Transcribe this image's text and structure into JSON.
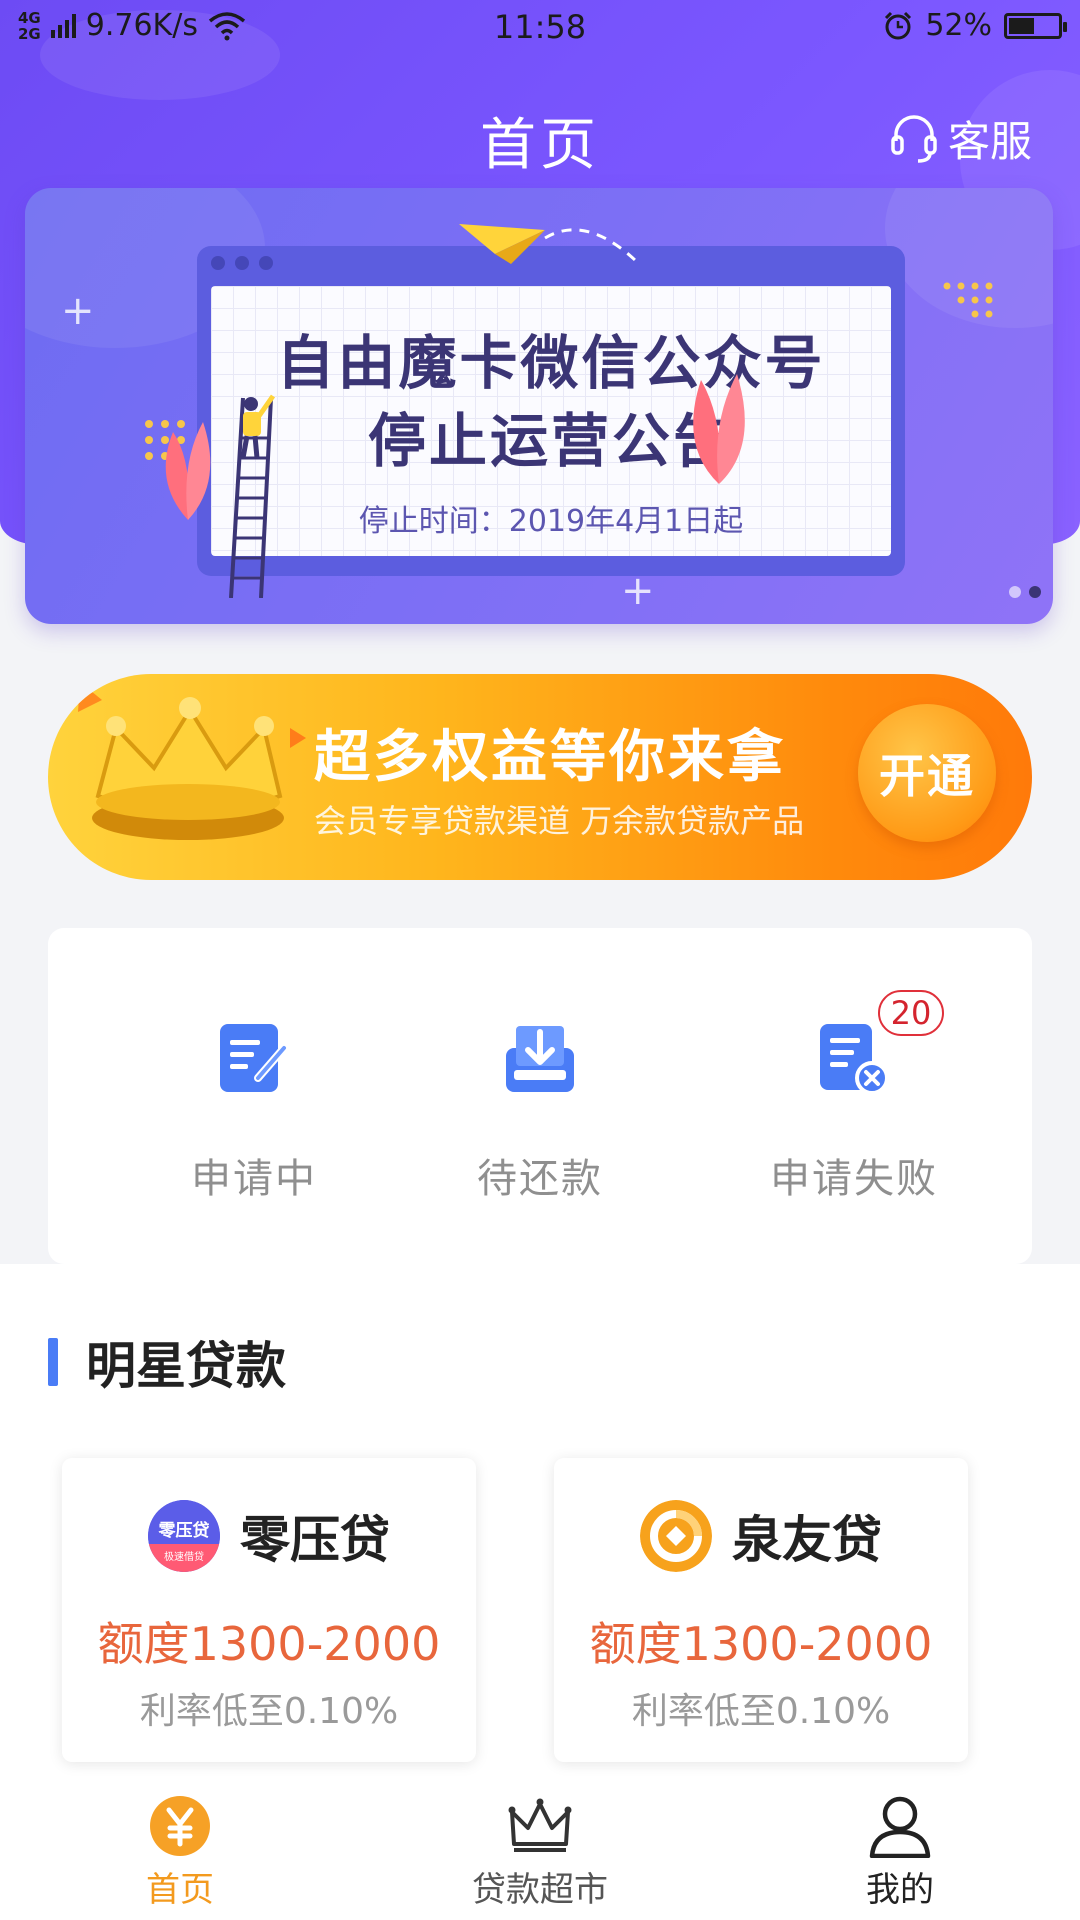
{
  "status_bar": {
    "network": "4G 2G",
    "speed": "9.76K/s",
    "time": "11:58",
    "battery": "52%",
    "battery_level": 0.52
  },
  "header": {
    "title": "首页",
    "service_label": "客服"
  },
  "banner": {
    "line1": "自由魔卡微信公众号",
    "line2": "停止运营公告",
    "subtitle": "停止时间：2019年4月1日起",
    "active_index": 1,
    "count": 2
  },
  "vip": {
    "title": "超多权益等你来拿",
    "subtitle": "会员专享贷款渠道 万余款贷款产品",
    "button": "开通"
  },
  "status_items": [
    {
      "label": "申请中",
      "icon": "edit-document-icon"
    },
    {
      "label": "待还款",
      "icon": "download-tray-icon"
    },
    {
      "label": "申请失败",
      "icon": "document-failed-icon",
      "badge": "20"
    }
  ],
  "featured": {
    "title": "明星贷款",
    "loans": [
      {
        "name": "零压贷",
        "logo_text": "零压贷",
        "logo_sub": "极速借贷",
        "amount": "额度1300-2000",
        "rate": "利率低至0.10%"
      },
      {
        "name": "泉友贷",
        "amount": "额度1300-2000",
        "rate": "利率低至0.10%"
      }
    ]
  },
  "bottom_nav": [
    {
      "label": "首页",
      "icon": "yuan-coin-icon",
      "active": true
    },
    {
      "label": "贷款超市",
      "icon": "crown-icon",
      "active": false
    },
    {
      "label": "我的",
      "icon": "user-icon",
      "active": false
    }
  ],
  "colors": {
    "header_purple": "#7b57ff",
    "accent_orange": "#f39a1e",
    "amount_orange": "#e8663c",
    "section_blue": "#4a7cf6",
    "badge_red": "#e0303a"
  }
}
